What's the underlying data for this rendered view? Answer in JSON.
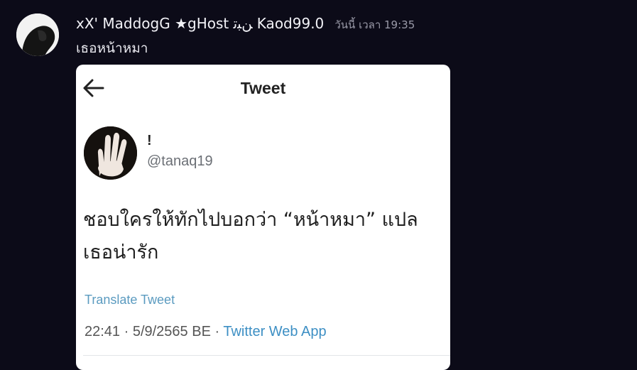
{
  "message": {
    "username": "xX' MaddogG ★gHost ﻦﺒﺗ Kaod99.0",
    "timestamp": "วันนี้ เวลา 19:35",
    "text": "เธอหน้าหมา"
  },
  "tweet": {
    "header_title": "Tweet",
    "display_name": "!",
    "handle": "@tanaq19",
    "body_line1": "ชอบใครให้ทักไปบอกว่า “หน้าหมา” แปล",
    "body_line2": "เธอน่ารัก",
    "translate_label": "Translate Tweet",
    "date_text": "22:41 · 5/9/2565 BE · ",
    "source": "Twitter Web App"
  },
  "icons": {
    "back": "arrow-left",
    "avatar": "user-avatar",
    "tweet_avatar": "hand-photo"
  },
  "colors": {
    "background": "#0c0b18",
    "link": "#3d8fc4"
  }
}
